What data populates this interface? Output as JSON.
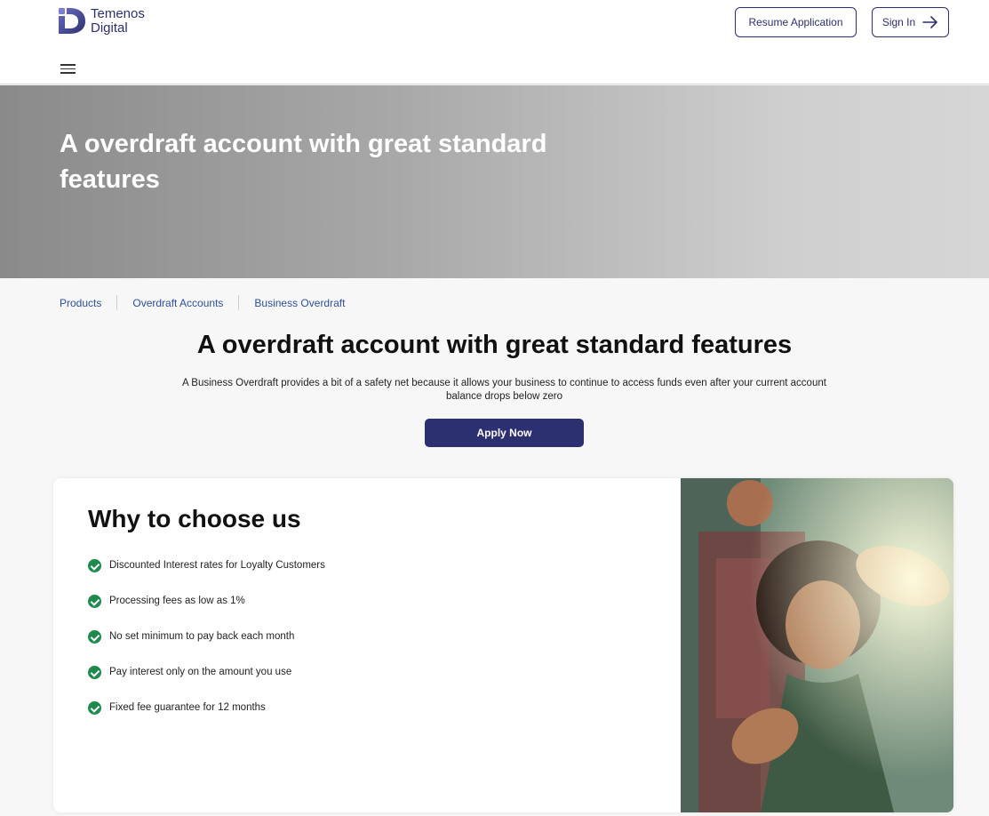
{
  "header": {
    "logo_line1": "Temenos",
    "logo_line2": "Digital",
    "resume_label": "Resume Application",
    "signin_label": "Sign In"
  },
  "hero": {
    "title": "A overdraft account with great standard features"
  },
  "breadcrumb": {
    "items": [
      "Products",
      "Overdraft Accounts",
      "Business Overdraft"
    ]
  },
  "main": {
    "title": "A overdraft account with great standard features",
    "description": "A Business Overdraft provides a bit of a safety net because it allows your business to continue to access funds even after your current account balance drops below zero",
    "apply_label": "Apply Now"
  },
  "why": {
    "title": "Why to choose us",
    "features": [
      "Discounted Interest rates for Loyalty Customers",
      "Processing fees as low as 1%",
      "No set minimum to pay back each month",
      "Pay interest only on the amount you use",
      "Fixed fee guarantee for 12 months"
    ]
  },
  "colors": {
    "brand": "#2d2f6e",
    "check": "#1f8a4c",
    "link": "#2d4f9a"
  }
}
